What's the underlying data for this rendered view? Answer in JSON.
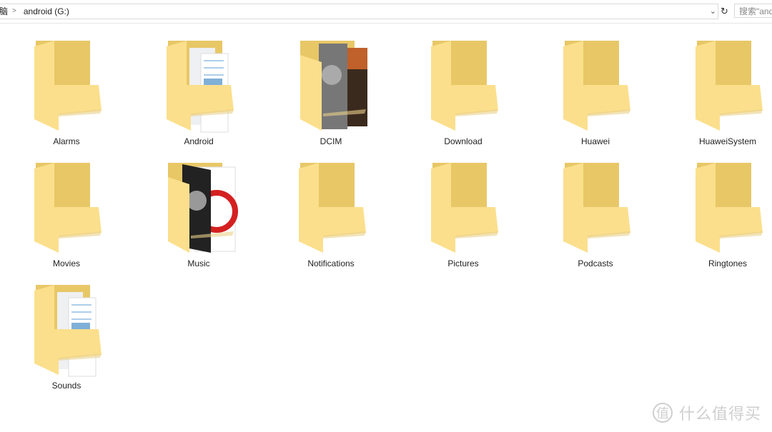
{
  "address_bar": {
    "prefix": "脑",
    "path": [
      "android (G:)"
    ]
  },
  "search": {
    "placeholder": "搜索\"and"
  },
  "folders": [
    {
      "name": "Alarms",
      "content": "empty"
    },
    {
      "name": "Android",
      "content": "documents"
    },
    {
      "name": "DCIM",
      "content": "photos"
    },
    {
      "name": "Download",
      "content": "empty"
    },
    {
      "name": "Huawei",
      "content": "empty"
    },
    {
      "name": "HuaweiSystem",
      "content": "empty"
    },
    {
      "name": "Movies",
      "content": "empty"
    },
    {
      "name": "Music",
      "content": "album"
    },
    {
      "name": "Notifications",
      "content": "empty"
    },
    {
      "name": "Pictures",
      "content": "empty"
    },
    {
      "name": "Podcasts",
      "content": "empty"
    },
    {
      "name": "Ringtones",
      "content": "empty"
    },
    {
      "name": "Sounds",
      "content": "documents"
    }
  ],
  "watermark": "值 什么值得买",
  "colors": {
    "folder_back": "#e8c766",
    "folder_front": "#fbdf8c"
  }
}
